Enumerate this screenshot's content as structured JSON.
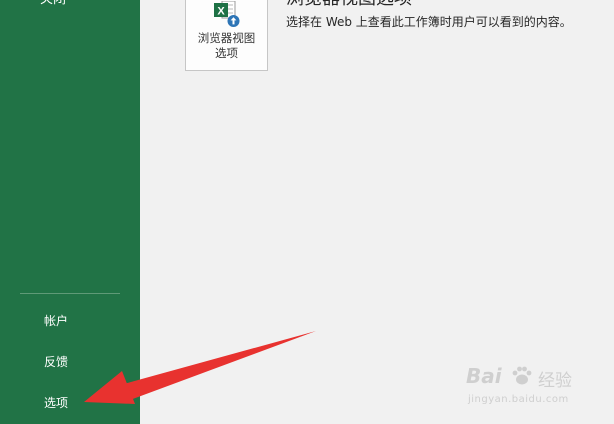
{
  "sidebar": {
    "top_item_label": "关闭",
    "items": [
      {
        "label": "帐户"
      },
      {
        "label": "反馈"
      },
      {
        "label": "选项"
      }
    ]
  },
  "main": {
    "browser_view": {
      "tile_label": "浏览器视图选项",
      "title": "浏览器视图选项",
      "description": "选择在 Web 上查看此工作簿时用户可以看到的内容。"
    }
  },
  "watermark": {
    "brand": "Bai",
    "brand_cn": "经验",
    "url": "jingyan.baidu.com"
  },
  "colors": {
    "sidebar_bg": "#217346",
    "content_bg": "#f1f1f1",
    "annotation_arrow": "#e8322f"
  }
}
